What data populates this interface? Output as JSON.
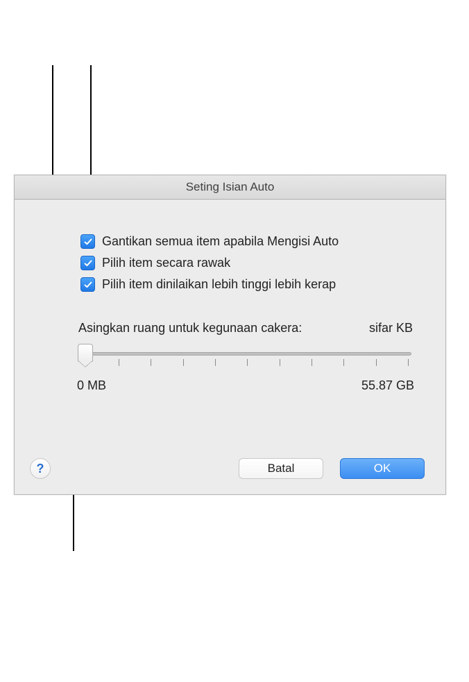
{
  "dialog": {
    "title": "Seting Isian Auto",
    "checkboxes": [
      {
        "label": "Gantikan semua item apabila Mengisi Auto",
        "checked": true
      },
      {
        "label": "Pilih item secara rawak",
        "checked": true
      },
      {
        "label": "Pilih item dinilaikan lebih tinggi lebih kerap",
        "checked": true
      }
    ],
    "slider": {
      "label": "Asingkan ruang untuk kegunaan cakera:",
      "value_label": "sifar KB",
      "min_label": "0 MB",
      "max_label": "55.87 GB"
    },
    "buttons": {
      "cancel": "Batal",
      "ok": "OK"
    },
    "help": "?"
  }
}
